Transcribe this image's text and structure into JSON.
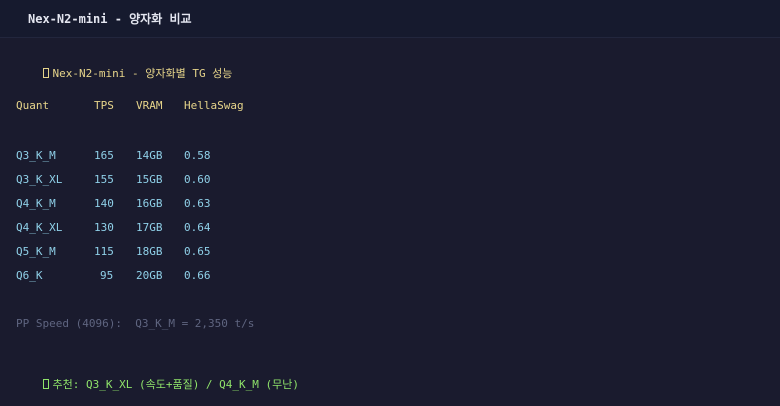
{
  "window": {
    "title": "Nex-N2-mini - 양자화 비교"
  },
  "report": {
    "heading": "Nex-N2-mini - 양자화별 TG 성능",
    "columns": [
      "Quant",
      "TPS",
      "VRAM",
      "HellaSwag"
    ],
    "rows": [
      {
        "quant": "Q3_K_M",
        "tps": "165",
        "vram": "14GB",
        "hellaswag": "0.58"
      },
      {
        "quant": "Q3_K_XL",
        "tps": "155",
        "vram": "15GB",
        "hellaswag": "0.60"
      },
      {
        "quant": "Q4_K_M",
        "tps": "140",
        "vram": "16GB",
        "hellaswag": "0.63"
      },
      {
        "quant": "Q4_K_XL",
        "tps": "130",
        "vram": "17GB",
        "hellaswag": "0.64"
      },
      {
        "quant": "Q5_K_M",
        "tps": "115",
        "vram": "18GB",
        "hellaswag": "0.65"
      },
      {
        "quant": "Q6_K",
        "tps": "95",
        "vram": "20GB",
        "hellaswag": "0.66"
      }
    ],
    "pp_speed": "PP Speed (4096):  Q3_K_M = 2,350 t/s",
    "recommendation": "추천: Q3_K_XL (속도+품질) / Q4_K_M (무난)"
  },
  "colors": {
    "background": "#1a1b2e",
    "heading": "#e6d48a",
    "values": "#8fd0e8",
    "muted": "#5f6580",
    "recommendation": "#8fe36a"
  },
  "icons": {
    "heading_icon": "missing-glyph-icon",
    "recommendation_icon": "missing-glyph-icon"
  }
}
